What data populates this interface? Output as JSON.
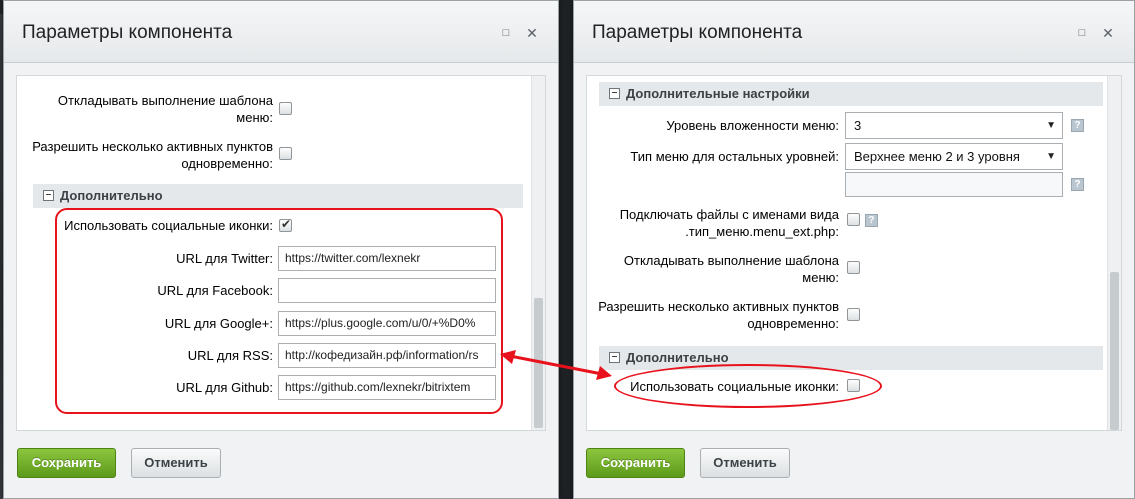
{
  "left_dialog": {
    "title": "Параметры компонента",
    "rows": {
      "defer_template": "Откладывать выполнение шаблона меню:",
      "multi_active": "Разрешить несколько активных пунктов одновременно:"
    },
    "section_additional": "Дополнительно",
    "use_social_icons": "Использовать социальные иконки:",
    "social": {
      "twitter_label": "URL для Twitter:",
      "twitter_value": "https://twitter.com/lexnekr",
      "facebook_label": "URL для Facebook:",
      "facebook_value": "",
      "googleplus_label": "URL для Google+:",
      "googleplus_value": "https://plus.google.com/u/0/+%D0%",
      "rss_label": "URL для RSS:",
      "rss_value": "http://кофедизайн.рф/information/rs",
      "github_label": "URL для Github:",
      "github_value": "https://github.com/lexnekr/bitrixtem"
    },
    "save_label": "Сохранить",
    "cancel_label": "Отменить"
  },
  "right_dialog": {
    "title": "Параметры компонента",
    "section_extra_settings": "Дополнительные настройки",
    "rows": {
      "nesting_level_label": "Уровень вложенности меню:",
      "nesting_level_value": "3",
      "menu_type_label": "Тип меню для остальных уровней:",
      "menu_type_value": "Верхнее меню 2 и 3 уровня",
      "include_files_label": "Подключать файлы с именами вида .тип_меню.menu_ext.php:",
      "defer_template": "Откладывать выполнение шаблона меню:",
      "multi_active": "Разрешить несколько активных пунктов одновременно:"
    },
    "section_additional": "Дополнительно",
    "use_social_icons": "Использовать социальные иконки:",
    "save_label": "Сохранить",
    "cancel_label": "Отменить"
  },
  "colors": {
    "annotation": "#e8121c",
    "save_button": "#6aab26"
  },
  "icons": {
    "maximize": "maximize-icon",
    "close": "close-icon",
    "collapse": "minus-box-icon",
    "help": "question-icon",
    "dropdown": "triangle-down-icon"
  }
}
